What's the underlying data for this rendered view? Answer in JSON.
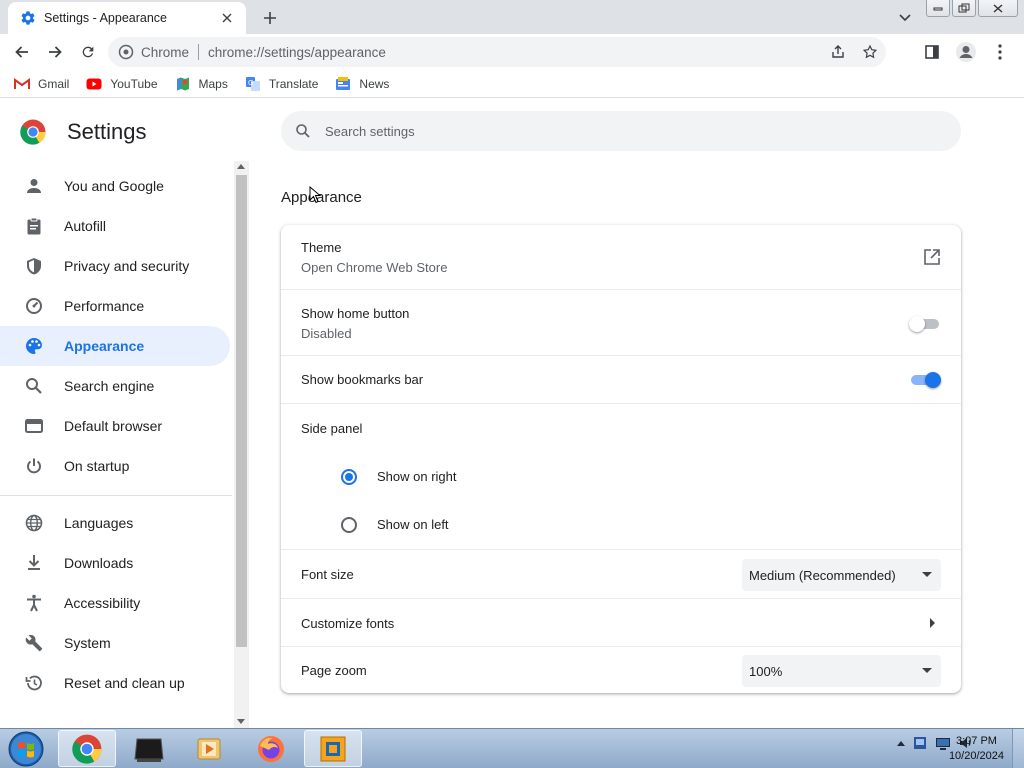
{
  "browser": {
    "tab_title": "Settings - Appearance",
    "omnibox_site": "Chrome",
    "omnibox_url": "chrome://settings/appearance",
    "bookmarks": [
      "Gmail",
      "YouTube",
      "Maps",
      "Translate",
      "News"
    ]
  },
  "settings": {
    "title": "Settings",
    "search_placeholder": "Search settings",
    "nav": [
      {
        "label": "You and Google",
        "icon": "person-icon"
      },
      {
        "label": "Autofill",
        "icon": "clipboard-icon"
      },
      {
        "label": "Privacy and security",
        "icon": "shield-icon"
      },
      {
        "label": "Performance",
        "icon": "speedometer-icon"
      },
      {
        "label": "Appearance",
        "icon": "palette-icon",
        "active": true
      },
      {
        "label": "Search engine",
        "icon": "search-icon"
      },
      {
        "label": "Default browser",
        "icon": "browser-window-icon"
      },
      {
        "label": "On startup",
        "icon": "power-icon"
      },
      {
        "label": "Languages",
        "icon": "globe-icon"
      },
      {
        "label": "Downloads",
        "icon": "download-icon"
      },
      {
        "label": "Accessibility",
        "icon": "accessibility-icon"
      },
      {
        "label": "System",
        "icon": "wrench-icon"
      },
      {
        "label": "Reset and clean up",
        "icon": "history-icon"
      }
    ],
    "section_title": "Appearance",
    "theme": {
      "label": "Theme",
      "sub": "Open Chrome Web Store"
    },
    "home_button": {
      "label": "Show home button",
      "sub": "Disabled",
      "enabled": false
    },
    "bookmarks_bar": {
      "label": "Show bookmarks bar",
      "enabled": true
    },
    "side_panel": {
      "label": "Side panel",
      "options": [
        "Show on right",
        "Show on left"
      ],
      "selected": "Show on right"
    },
    "font_size": {
      "label": "Font size",
      "value": "Medium (Recommended)"
    },
    "customize_fonts": {
      "label": "Customize fonts"
    },
    "page_zoom": {
      "label": "Page zoom",
      "value": "100%"
    }
  },
  "taskbar": {
    "time": "3:07 PM",
    "date": "10/20/2024"
  },
  "colors": {
    "accent": "#1a73e8",
    "active_nav_bg": "#e8f0fe"
  }
}
